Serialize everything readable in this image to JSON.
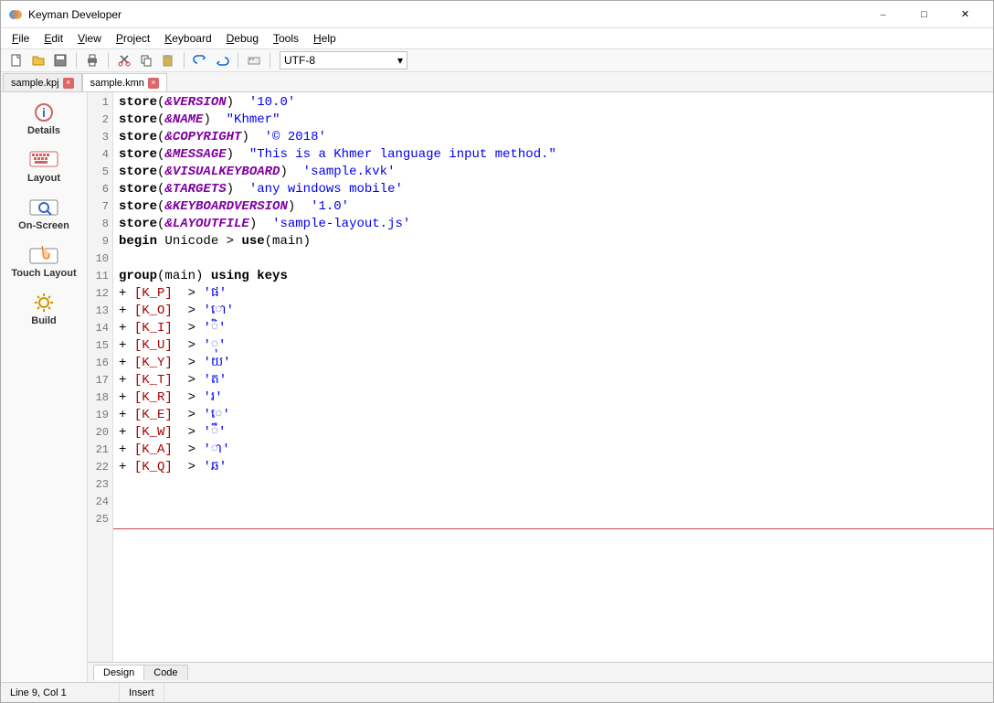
{
  "window": {
    "title": "Keyman Developer"
  },
  "menu": [
    "File",
    "Edit",
    "View",
    "Project",
    "Keyboard",
    "Debug",
    "Tools",
    "Help"
  ],
  "toolbar": {
    "encoding": "UTF-8"
  },
  "file_tabs": [
    {
      "label": "sample.kpj",
      "active": false
    },
    {
      "label": "sample.kmn",
      "active": true
    }
  ],
  "sidebar": [
    {
      "label": "Details",
      "name": "details"
    },
    {
      "label": "Layout",
      "name": "layout"
    },
    {
      "label": "On-Screen",
      "name": "on-screen"
    },
    {
      "label": "Touch Layout",
      "name": "touch-layout"
    },
    {
      "label": "Build",
      "name": "build"
    }
  ],
  "lines": [
    {
      "n": 1,
      "seg": [
        [
          "kw",
          "store"
        ],
        [
          "op",
          "("
        ],
        [
          "sys",
          "&VERSION"
        ],
        [
          "op",
          ")  "
        ],
        [
          "str",
          "'10.0'"
        ]
      ]
    },
    {
      "n": 2,
      "seg": [
        [
          "kw",
          "store"
        ],
        [
          "op",
          "("
        ],
        [
          "sys",
          "&NAME"
        ],
        [
          "op",
          ")  "
        ],
        [
          "str",
          "\"Khmer\""
        ]
      ]
    },
    {
      "n": 3,
      "seg": [
        [
          "kw",
          "store"
        ],
        [
          "op",
          "("
        ],
        [
          "sys",
          "&COPYRIGHT"
        ],
        [
          "op",
          ")  "
        ],
        [
          "str",
          "'© 2018'"
        ]
      ]
    },
    {
      "n": 4,
      "seg": [
        [
          "kw",
          "store"
        ],
        [
          "op",
          "("
        ],
        [
          "sys",
          "&MESSAGE"
        ],
        [
          "op",
          ")  "
        ],
        [
          "str",
          "\"This is a Khmer language input method.\""
        ]
      ]
    },
    {
      "n": 5,
      "seg": [
        [
          "kw",
          "store"
        ],
        [
          "op",
          "("
        ],
        [
          "sys",
          "&VISUALKEYBOARD"
        ],
        [
          "op",
          ")  "
        ],
        [
          "str",
          "'sample.kvk'"
        ]
      ]
    },
    {
      "n": 6,
      "seg": [
        [
          "kw",
          "store"
        ],
        [
          "op",
          "("
        ],
        [
          "sys",
          "&TARGETS"
        ],
        [
          "op",
          ")  "
        ],
        [
          "str",
          "'any windows mobile'"
        ]
      ]
    },
    {
      "n": 7,
      "seg": [
        [
          "kw",
          "store"
        ],
        [
          "op",
          "("
        ],
        [
          "sys",
          "&KEYBOARDVERSION"
        ],
        [
          "op",
          ")  "
        ],
        [
          "str",
          "'1.0'"
        ]
      ]
    },
    {
      "n": 8,
      "seg": [
        [
          "kw",
          "store"
        ],
        [
          "op",
          "("
        ],
        [
          "sys",
          "&LAYOUTFILE"
        ],
        [
          "op",
          ")  "
        ],
        [
          "str",
          "'sample-layout.js'"
        ]
      ]
    },
    {
      "n": 9,
      "seg": [
        [
          "kw",
          "begin"
        ],
        [
          "op",
          " Unicode > "
        ],
        [
          "kw",
          "use"
        ],
        [
          "op",
          "(main)"
        ]
      ]
    },
    {
      "n": 10,
      "seg": []
    },
    {
      "n": 11,
      "seg": [
        [
          "kw",
          "group"
        ],
        [
          "op",
          "(main) "
        ],
        [
          "kw",
          "using keys"
        ]
      ]
    },
    {
      "n": 12,
      "seg": [
        [
          "op",
          "+ "
        ],
        [
          "vk",
          "[K_P]"
        ],
        [
          "op",
          "  > "
        ],
        [
          "str",
          "'ផ'"
        ]
      ]
    },
    {
      "n": 13,
      "seg": [
        [
          "op",
          "+ "
        ],
        [
          "vk",
          "[K_O]"
        ],
        [
          "op",
          "  > "
        ],
        [
          "str",
          "'ោ'"
        ]
      ]
    },
    {
      "n": 14,
      "seg": [
        [
          "op",
          "+ "
        ],
        [
          "vk",
          "[K_I]"
        ],
        [
          "op",
          "  > "
        ],
        [
          "str",
          "'ិ'"
        ]
      ]
    },
    {
      "n": 15,
      "seg": [
        [
          "op",
          "+ "
        ],
        [
          "vk",
          "[K_U]"
        ],
        [
          "op",
          "  > "
        ],
        [
          "str",
          "'ុ'"
        ]
      ]
    },
    {
      "n": 16,
      "seg": [
        [
          "op",
          "+ "
        ],
        [
          "vk",
          "[K_Y]"
        ],
        [
          "op",
          "  > "
        ],
        [
          "str",
          "'យ'"
        ]
      ]
    },
    {
      "n": 17,
      "seg": [
        [
          "op",
          "+ "
        ],
        [
          "vk",
          "[K_T]"
        ],
        [
          "op",
          "  > "
        ],
        [
          "str",
          "'ត'"
        ]
      ]
    },
    {
      "n": 18,
      "seg": [
        [
          "op",
          "+ "
        ],
        [
          "vk",
          "[K_R]"
        ],
        [
          "op",
          "  > "
        ],
        [
          "str",
          "'រ'"
        ]
      ]
    },
    {
      "n": 19,
      "seg": [
        [
          "op",
          "+ "
        ],
        [
          "vk",
          "[K_E]"
        ],
        [
          "op",
          "  > "
        ],
        [
          "str",
          "'េ'"
        ]
      ]
    },
    {
      "n": 20,
      "seg": [
        [
          "op",
          "+ "
        ],
        [
          "vk",
          "[K_W]"
        ],
        [
          "op",
          "  > "
        ],
        [
          "str",
          "'ឹ'"
        ]
      ]
    },
    {
      "n": 21,
      "seg": [
        [
          "op",
          "+ "
        ],
        [
          "vk",
          "[K_A]"
        ],
        [
          "op",
          "  > "
        ],
        [
          "str",
          "'ា'"
        ]
      ]
    },
    {
      "n": 22,
      "seg": [
        [
          "op",
          "+ "
        ],
        [
          "vk",
          "[K_Q]"
        ],
        [
          "op",
          "  > "
        ],
        [
          "str",
          "'ឆ'"
        ]
      ]
    },
    {
      "n": 23,
      "seg": []
    },
    {
      "n": 24,
      "seg": []
    },
    {
      "n": 25,
      "seg": []
    }
  ],
  "bottom_tabs": [
    {
      "label": "Design",
      "active": true
    },
    {
      "label": "Code",
      "active": false
    }
  ],
  "status": {
    "pos": "Line 9, Col 1",
    "mode": "Insert"
  }
}
